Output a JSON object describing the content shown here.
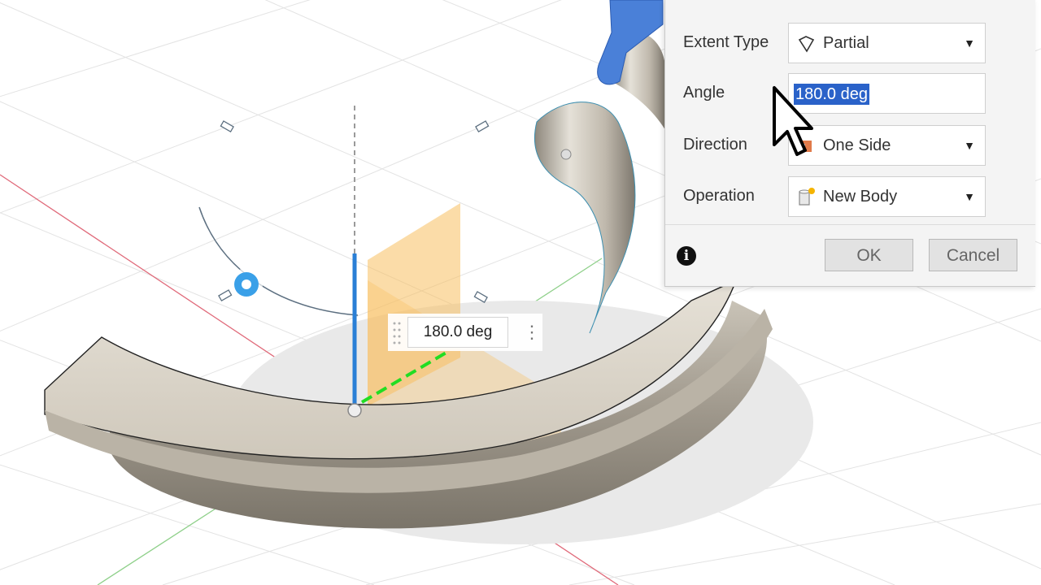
{
  "dialog": {
    "extent_type": {
      "label": "Extent Type",
      "value": "Partial",
      "icon": "partial-extent-icon"
    },
    "angle": {
      "label": "Angle",
      "value": "180.0 deg"
    },
    "direction": {
      "label": "Direction",
      "value": "One Side",
      "icon": "one-side-icon"
    },
    "operation": {
      "label": "Operation",
      "value": "New Body",
      "icon": "new-body-icon"
    },
    "ok_label": "OK",
    "cancel_label": "Cancel",
    "info_icon": "info-icon"
  },
  "canvas": {
    "angle_value": "180.0 deg",
    "more_icon": "vertical-ellipsis-icon"
  },
  "colors": {
    "selection": "#2a62c9",
    "model": "#d8d2c6",
    "manipulator_blue": "#2a7fd6",
    "plane_orange": "#f8c060"
  }
}
